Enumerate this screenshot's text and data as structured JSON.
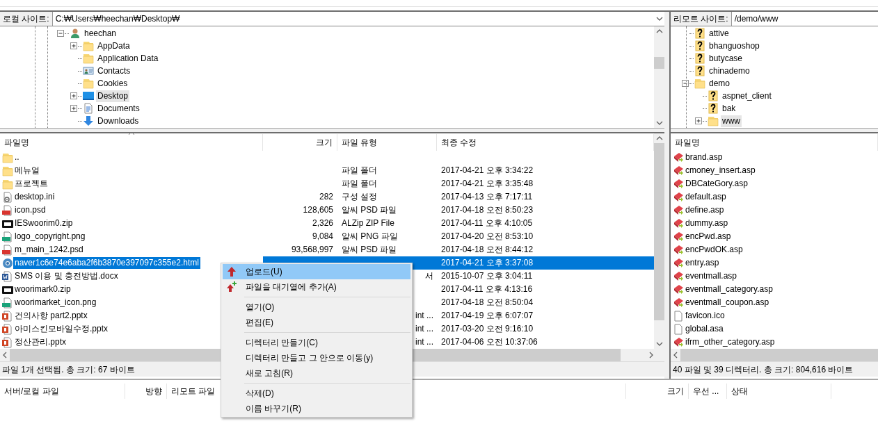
{
  "local": {
    "site_label": "로컬 사이트:",
    "path": "C:₩Users₩heechan₩Desktop₩",
    "tree": [
      {
        "label": "heechan",
        "kind": "user",
        "expanded": true,
        "selected": false,
        "children": [
          {
            "label": "AppData",
            "kind": "folder",
            "expanded": false,
            "selected": false
          },
          {
            "label": "Application Data",
            "kind": "folder",
            "selected": false
          },
          {
            "label": "Contacts",
            "kind": "contacts",
            "selected": false
          },
          {
            "label": "Cookies",
            "kind": "folder",
            "selected": false
          },
          {
            "label": "Desktop",
            "kind": "desktop",
            "expanded": false,
            "selected": true
          },
          {
            "label": "Documents",
            "kind": "documents",
            "expanded": false,
            "selected": false
          },
          {
            "label": "Downloads",
            "kind": "downloads",
            "selected": false
          }
        ]
      }
    ],
    "columns": [
      {
        "label": "파일명",
        "sorted": true
      },
      {
        "label": "크기"
      },
      {
        "label": "파일 유형"
      },
      {
        "label": "최종 수정"
      }
    ],
    "rows": [
      {
        "kind": "folder",
        "name": "..",
        "selected": false
      },
      {
        "kind": "folder",
        "name": "메뉴얼",
        "type": "파일 폴더",
        "modified": "2017-04-21 오후 3:34:22",
        "selected": false
      },
      {
        "kind": "folder",
        "name": "프로젝트",
        "type": "파일 폴더",
        "modified": "2017-04-21 오후 3:35:48",
        "selected": false
      },
      {
        "kind": "settings",
        "name": "desktop.ini",
        "size": "282",
        "type": "구성 설정",
        "modified": "2017-04-13 오후 7:17:11",
        "selected": false
      },
      {
        "kind": "psd",
        "name": "icon.psd",
        "size": "128,605",
        "type": "알씨 PSD 파일",
        "modified": "2017-04-18 오전 8:50:23",
        "selected": false
      },
      {
        "kind": "zip",
        "name": "IESwoorim0.zip",
        "size": "2,326",
        "type": "ALZip ZIP File",
        "modified": "2017-04-11 오후 4:10:05",
        "selected": false
      },
      {
        "kind": "png",
        "name": "logo_copyright.png",
        "size": "9,084",
        "type": "알씨 PNG 파일",
        "modified": "2017-04-20 오전 8:53:10",
        "selected": false
      },
      {
        "kind": "psd",
        "name": "m_main_1242.psd",
        "size": "93,568,997",
        "type": "알씨 PSD 파일",
        "modified": "2017-04-18 오전 8:44:12",
        "selected": false
      },
      {
        "kind": "html",
        "name": "naver1c6e74e6aba2f6b3870e397097c355e2.html",
        "modified": "2017-04-21 오후 3:37:08",
        "selected": true
      },
      {
        "kind": "word",
        "name": "SMS 이용 및 충전방법.docx",
        "type": "서",
        "type_tail": true,
        "modified": "2015-10-07 오후 3:04:11",
        "selected": false
      },
      {
        "kind": "zip",
        "name": "woorimark0.zip",
        "modified": "2017-04-11 오후 4:13:16",
        "selected": false
      },
      {
        "kind": "png",
        "name": "woorimarket_icon.png",
        "modified": "2017-04-18 오전 8:50:04",
        "selected": false
      },
      {
        "kind": "ppt",
        "name": "건의사항 part2.pptx",
        "type": "int ...",
        "type_tail": true,
        "modified": "2017-04-19 오후 6:07:07",
        "selected": false
      },
      {
        "kind": "ppt",
        "name": "아미스킨모바일수정.pptx",
        "type": "int ...",
        "type_tail": true,
        "modified": "2017-03-20 오전 9:16:10",
        "selected": false
      },
      {
        "kind": "ppt",
        "name": "정산관리.pptx",
        "type": "int ...",
        "type_tail": true,
        "modified": "2017-04-06 오전 10:37:06",
        "selected": false
      }
    ],
    "status": "파일 1개 선택됨. 총 크기: 67 바이트"
  },
  "remote": {
    "site_label": "리모트 사이트:",
    "path": "/demo/www",
    "tree": [
      {
        "label": "attive",
        "kind": "unknown",
        "selected": false
      },
      {
        "label": "bhanguoshop",
        "kind": "unknown",
        "selected": false
      },
      {
        "label": "butycase",
        "kind": "unknown",
        "selected": false
      },
      {
        "label": "chinademo",
        "kind": "unknown",
        "selected": false
      },
      {
        "label": "demo",
        "kind": "folder",
        "expanded": true,
        "selected": false,
        "children": [
          {
            "label": "aspnet_client",
            "kind": "unknown",
            "selected": false
          },
          {
            "label": "bak",
            "kind": "unknown",
            "selected": false
          },
          {
            "label": "www",
            "kind": "folder",
            "expanded": false,
            "selected": true
          }
        ]
      }
    ],
    "columns": [
      {
        "label": "파일명"
      }
    ],
    "rows": [
      {
        "kind": "asp",
        "name": "brand.asp"
      },
      {
        "kind": "asp",
        "name": "cmoney_insert.asp"
      },
      {
        "kind": "asp",
        "name": "DBCateGory.asp"
      },
      {
        "kind": "asp",
        "name": "default.asp"
      },
      {
        "kind": "asp",
        "name": "define.asp"
      },
      {
        "kind": "asp",
        "name": "dummy.asp"
      },
      {
        "kind": "asp",
        "name": "encPwd.asp"
      },
      {
        "kind": "asp",
        "name": "encPwdOK.asp"
      },
      {
        "kind": "asp",
        "name": "entry.asp"
      },
      {
        "kind": "asp",
        "name": "eventmall.asp"
      },
      {
        "kind": "asp",
        "name": "eventmall_category.asp"
      },
      {
        "kind": "asp",
        "name": "eventmall_coupon.asp"
      },
      {
        "kind": "file",
        "name": "favicon.ico"
      },
      {
        "kind": "file",
        "name": "global.asa"
      },
      {
        "kind": "asp",
        "name": "ifrm_other_category.asp"
      }
    ],
    "status": "40 파일 및 39 디렉터리. 총 크기: 804,616 바이트"
  },
  "queue": {
    "columns": [
      "서버/로컬 파일",
      "방향",
      "리모트 파일",
      "크기",
      "우선 ...",
      "상태"
    ]
  },
  "context_menu": {
    "groups": [
      [
        {
          "label": "업로드(U)",
          "kind": "upload",
          "selected": true
        },
        {
          "label": "파일을 대기열에 추가(A)",
          "kind": "enqueue",
          "selected": false
        }
      ],
      [
        {
          "label": "열기(O)",
          "selected": false
        },
        {
          "label": "편집(E)",
          "selected": false
        }
      ],
      [
        {
          "label": "디렉터리 만들기(C)",
          "selected": false
        },
        {
          "label": "디렉터리 만들고 그 안으로 이동(y)",
          "selected": false
        },
        {
          "label": "새로 고침(R)",
          "selected": false
        }
      ],
      [
        {
          "label": "삭제(D)",
          "selected": false
        },
        {
          "label": "이름 바꾸기(R)",
          "selected": false
        }
      ]
    ]
  }
}
